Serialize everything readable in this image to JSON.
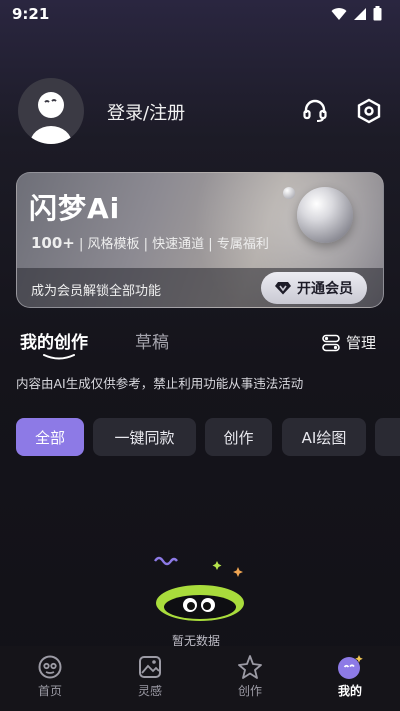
{
  "status_bar": {
    "time": "9:21"
  },
  "profile": {
    "login_label": "登录/注册"
  },
  "vip_card": {
    "logo": "闪梦Ai",
    "features_first": "100+",
    "features_rest": " | 风格模板 | 快速通道 | 专属福利",
    "unlock_text": "成为会员解锁全部功能",
    "open_button": "开通会员"
  },
  "tabs": {
    "active": "我的创作",
    "inactive": "草稿",
    "manage": "管理"
  },
  "notice": "内容由AI生成仅供参考，禁止利用功能从事违法活动",
  "chips": [
    "全部",
    "一键同款",
    "创作",
    "AI绘图"
  ],
  "empty_text": "暂无数据",
  "bottom_nav": [
    {
      "label": "首页",
      "icon": "home-face-icon"
    },
    {
      "label": "灵感",
      "icon": "inspiration-image-icon"
    },
    {
      "label": "创作",
      "icon": "create-star-icon"
    },
    {
      "label": "我的",
      "icon": "my-profile-icon"
    }
  ],
  "colors": {
    "accent": "#8d7ae6",
    "chip_bg": "#2a2a33",
    "nav_active": "#ffffff"
  }
}
